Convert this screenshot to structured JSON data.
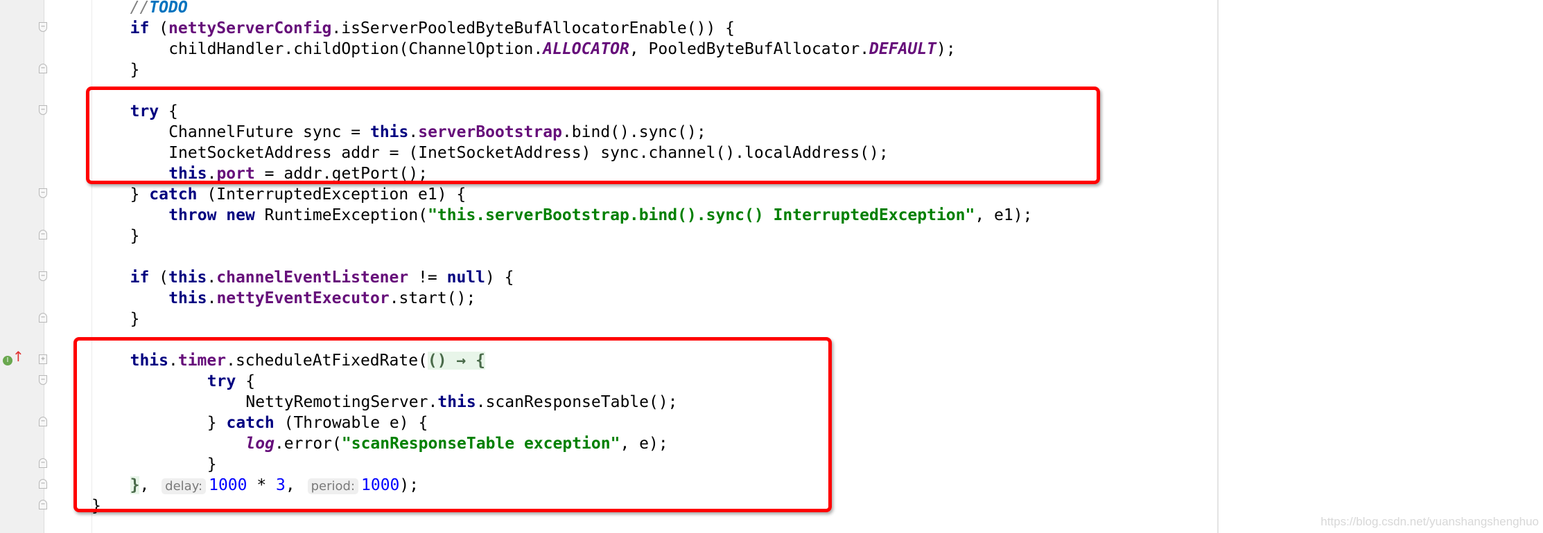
{
  "editor": {
    "watermark": "https://blog.csdn.net/yuanshangshenghuo",
    "highlight_color": "#ff0000",
    "gutter_icons": {
      "implements_marker": "I",
      "arrow": "↑"
    },
    "lines": [
      {
        "indent": 4,
        "tokens": [
          {
            "t": "//",
            "c": "cmt"
          },
          {
            "t": "TODO",
            "c": "todo"
          }
        ]
      },
      {
        "indent": 4,
        "tokens": [
          {
            "t": "if",
            "c": "kw"
          },
          {
            "t": " ("
          },
          {
            "t": "nettyServerConfig",
            "c": "fld"
          },
          {
            "t": ".isServerPooledByteBufAllocatorEnable()) {"
          }
        ]
      },
      {
        "indent": 8,
        "tokens": [
          {
            "t": "childHandler.childOption(ChannelOption."
          },
          {
            "t": "ALLOCATOR",
            "c": "sfld"
          },
          {
            "t": ", PooledByteBufAllocator."
          },
          {
            "t": "DEFAULT",
            "c": "sfld"
          },
          {
            "t": ");"
          }
        ]
      },
      {
        "indent": 4,
        "tokens": [
          {
            "t": "}"
          }
        ]
      },
      {
        "indent": 0,
        "tokens": []
      },
      {
        "indent": 4,
        "tokens": [
          {
            "t": "try",
            "c": "kw"
          },
          {
            "t": " {"
          }
        ]
      },
      {
        "indent": 8,
        "tokens": [
          {
            "t": "ChannelFuture sync = "
          },
          {
            "t": "this",
            "c": "kw"
          },
          {
            "t": "."
          },
          {
            "t": "serverBootstrap",
            "c": "fld"
          },
          {
            "t": ".bind().sync();"
          }
        ]
      },
      {
        "indent": 8,
        "tokens": [
          {
            "t": "InetSocketAddress addr = (InetSocketAddress) sync.channel().localAddress();"
          }
        ]
      },
      {
        "indent": 8,
        "tokens": [
          {
            "t": "this",
            "c": "kw"
          },
          {
            "t": "."
          },
          {
            "t": "port",
            "c": "fld"
          },
          {
            "t": " = addr.getPort();"
          }
        ]
      },
      {
        "indent": 4,
        "tokens": [
          {
            "t": "} "
          },
          {
            "t": "catch",
            "c": "kw"
          },
          {
            "t": " (InterruptedException e1) {"
          }
        ]
      },
      {
        "indent": 8,
        "tokens": [
          {
            "t": "throw new",
            "c": "kw"
          },
          {
            "t": " RuntimeException("
          },
          {
            "t": "\"this.serverBootstrap.bind().sync() InterruptedException\"",
            "c": "str"
          },
          {
            "t": ", e1);"
          }
        ]
      },
      {
        "indent": 4,
        "tokens": [
          {
            "t": "}"
          }
        ]
      },
      {
        "indent": 0,
        "tokens": []
      },
      {
        "indent": 4,
        "tokens": [
          {
            "t": "if",
            "c": "kw"
          },
          {
            "t": " ("
          },
          {
            "t": "this",
            "c": "kw"
          },
          {
            "t": "."
          },
          {
            "t": "channelEventListener",
            "c": "fld"
          },
          {
            "t": " != "
          },
          {
            "t": "null",
            "c": "kw"
          },
          {
            "t": ") {"
          }
        ]
      },
      {
        "indent": 8,
        "tokens": [
          {
            "t": "this",
            "c": "kw"
          },
          {
            "t": "."
          },
          {
            "t": "nettyEventExecutor",
            "c": "fld"
          },
          {
            "t": ".start();"
          }
        ]
      },
      {
        "indent": 4,
        "tokens": [
          {
            "t": "}"
          }
        ]
      },
      {
        "indent": 0,
        "tokens": []
      },
      {
        "indent": 4,
        "tokens": [
          {
            "t": "this",
            "c": "kw"
          },
          {
            "t": "."
          },
          {
            "t": "timer",
            "c": "fld"
          },
          {
            "t": ".scheduleAtFixedRate("
          },
          {
            "t": "() → {",
            "c": "lam"
          }
        ]
      },
      {
        "indent": 12,
        "tokens": [
          {
            "t": "try",
            "c": "kw"
          },
          {
            "t": " {"
          }
        ]
      },
      {
        "indent": 16,
        "tokens": [
          {
            "t": "NettyRemotingServer."
          },
          {
            "t": "this",
            "c": "kw"
          },
          {
            "t": ".scanResponseTable();"
          }
        ]
      },
      {
        "indent": 12,
        "tokens": [
          {
            "t": "} "
          },
          {
            "t": "catch",
            "c": "kw"
          },
          {
            "t": " (Throwable e) {"
          }
        ]
      },
      {
        "indent": 16,
        "tokens": [
          {
            "t": "log",
            "c": "sfld"
          },
          {
            "t": ".error("
          },
          {
            "t": "\"scanResponseTable exception\"",
            "c": "str"
          },
          {
            "t": ", e);"
          }
        ]
      },
      {
        "indent": 12,
        "tokens": [
          {
            "t": "}"
          }
        ]
      },
      {
        "indent": 4,
        "tokens": [
          {
            "t": "}",
            "c": "lam"
          },
          {
            "t": ", "
          },
          {
            "t": "delay:",
            "c": "hint"
          },
          {
            "t": "1000",
            "c": "num"
          },
          {
            "t": " * "
          },
          {
            "t": "3",
            "c": "num"
          },
          {
            "t": ", "
          },
          {
            "t": "period:",
            "c": "hint"
          },
          {
            "t": "1000",
            "c": "num"
          },
          {
            "t": ");"
          }
        ]
      },
      {
        "indent": 0,
        "tokens": [
          {
            "t": "}"
          }
        ]
      }
    ]
  }
}
